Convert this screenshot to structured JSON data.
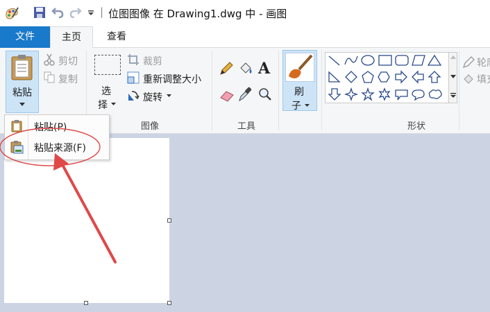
{
  "window": {
    "title": "位图图像 在 Drawing1.dwg 中 - 画图",
    "qat_separator": "|"
  },
  "tabs": {
    "file": "文件",
    "home": "主页",
    "view": "查看"
  },
  "ribbon": {
    "clipboard": {
      "paste_line1": "粘贴",
      "cut": "剪切",
      "copy": "复制"
    },
    "image": {
      "select_line1": "选",
      "select_line2": "择",
      "crop": "裁剪",
      "resize": "重新调整大小",
      "rotate": "旋转",
      "group_label": "图像"
    },
    "tools": {
      "group_label": "工具",
      "text_glyph": "A"
    },
    "brushes": {
      "line1": "刷",
      "line2": "子"
    },
    "shapes": {
      "group_label": "形状",
      "outline": "轮廓",
      "fill": "填充"
    }
  },
  "paste_menu": {
    "items": [
      {
        "label": "粘贴(P)"
      },
      {
        "label": "粘贴来源(F)"
      }
    ]
  },
  "colors": {
    "accent": "#1979ca",
    "annotation": "#e04848",
    "workspace": "#ccd4e4"
  }
}
